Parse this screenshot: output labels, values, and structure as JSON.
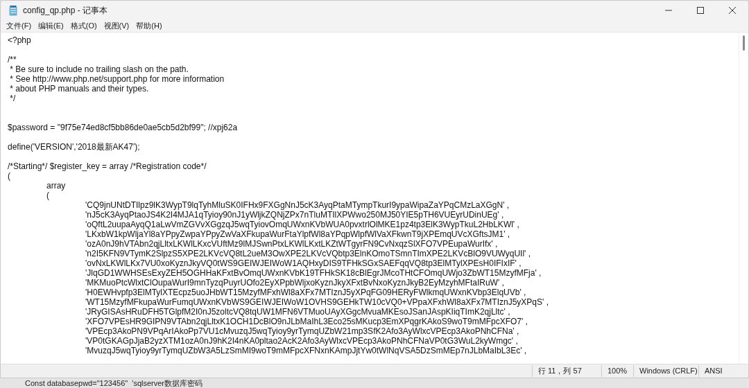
{
  "window": {
    "title": "config_qp.php - 记事本"
  },
  "menu": [
    "文件(F)",
    "编辑(E)",
    "格式(O)",
    "视图(V)",
    "帮助(H)"
  ],
  "editor": {
    "blocks": [
      {
        "kind": "first",
        "lines": [
          "<?php"
        ]
      },
      {
        "kind": "para",
        "lines": [
          "/**",
          " * Be sure to include no trailing slash on the path.",
          " * See http://www.php.net/support.php for more information",
          " * about PHP manuals and their types.",
          " */"
        ]
      },
      {
        "kind": "section",
        "lines": [
          "$password = \"9f75e74ed8cf5bb86de0ae5cb5d2bf99\"; //xpj62a"
        ]
      },
      {
        "kind": "para",
        "lines": [
          "define('VERSION','2018最新AK47');"
        ]
      },
      {
        "kind": "para",
        "lines": [
          "/*Starting*/ $register_key = array /*Registration code*/",
          "(",
          "\tarray",
          "\t(",
          "\t\t'CQ9jnUNtDTIlpz9lK3WypT9lqTyhMluSK0IFHx9FXGgNnJ5cK3AyqPtaMTympTkurI9ypaWipaZaYPqCMzLaXGgN' ,",
          "\t\t'nJ5cK3AyqPtaoJS4K2I4MJA1qTyioy90nJ1yWljkZQNjZPx7nTluMTIlXPWwo250MJ50YIE5pTH6VUEyrUDinUEg' ,",
          "\t\t'oQftL2uupaAyqQ1aLwVmZGVvXGgzqJ5wqTyiovOmqUWxnKVbWUA0pvxtrlOlMKE1pz4tp3ElK3WypTkuL2HbLKWl' ,",
          "\t\t'LKxbW1kpWljaYl8aYPpyZwpaYPpyZwVaXFkupaWurFtaYlpfWl8aYPqpWlpfWlVaXFkwnT9jXPEmqUVcXGftsJM1' ,",
          "\t\t'ozA0nJ9hVTAbn2qjLltxLKWlLKxcVUftMz9lMJSwnPtxLKWlLKxtLKZtWTgyrFN9CvNxqzSlXFO7VPEupaWurIfx' ,",
          "\t\t'n2I5KFN9VTymK2SlpzS5XPE2LKVcVQ8tL2ueM3OwXPE2LKVcVQbtp3ElnKOmoTSmnTImXPE2LKVcBlO9VUWyqUIl' ,",
          "\t\t'ovNxLKWlLKx7VU0xoKyznJkyVQ0tWS9GEIWJEIWoW1AQHxyDIS9TFHkSGxSAEFqqVQ8tp3ElMTylXPEsH0IFIxIF' ,",
          "\t\t'JlqGD1WWHSEsExyZEH5OGHHaKFxtBvOmqUWxnKVbK19TFHkSK18cBlEgrJMcoTHtCFOmqUWjo3ZbWT15MzyfMFja' ,",
          "\t\t'MKMuoPtcWlxtClOupaWurI9mnTyzqPuyrUOfo2EyXPpbWljxoKyznJkyXFxtBvNxoKyznJkyB2EyMzyhMFtaIRuW' ,",
          "\t\t'H0EWHvpfp3ElMTylXTEcpz5uoJHbWT15MzyfMFxhWl8aXFx7MTIznJ5yXPqFG09HERyFWlkmqUWxnKVbp3ElqUVb' ,",
          "\t\t'WT15MzyfMFkupaWurFumqUWxnKVbWS9GEIWJEIWoW1OVHS9GEHkTW10cVQ0+VPpaXFxhWl8aXFx7MTIznJ5yXPqS' ,",
          "\t\t'JRyGISAsHRuDFH5TGlpfM2I0nJ5zoltcVQ8tqUW1MFN6VTMuoUAyXGgcMvuaMKEsoJSanJAspKIiqTImK2qjLltc' ,",
          "\t\t'XFO7VPEsHR9GIPN9VTAbn2qjLltxK1OCH1DcBlO9nJLbMaIhL3Eco25sMKucp3EmXPqgrKAkoS9woT9mMFpcXFO7' ,",
          "\t\t'VPEcp3AkoPN9VPqArIAkoPp7VU1cMvuzqJ5wqTyioy9yrTymqUZbW21mp3SfK2Afo3AyWlxcVPEcp3AkoPNhCFNa' ,",
          "\t\t'VP0tGKAGpJjaB2yzXTM1ozA0nJ9hK2I4nKA0pltao2AcK2Afo3AyWlxcVPEcp3AkoPNhCFNaVP0tG3WuL2kyWmgc' ,",
          "\t\t'MvuzqJ5wqTyioy9yrTymqUZbW3A5LzSmMI9woT9mMFpcXFNxnKAmpJjtYw0tWlNqVSA5DzSmMEp7nJLbMaIbL3Ec' ,"
        ]
      }
    ]
  },
  "status_bar": {
    "position": "行 11，列 57",
    "zoom": "100%",
    "line_ending": "Windows (CRLF)",
    "encoding": "ANSI"
  },
  "background_window": {
    "text": "Const databasepwd=\"123456\"  'sqlserver数据库密码"
  }
}
